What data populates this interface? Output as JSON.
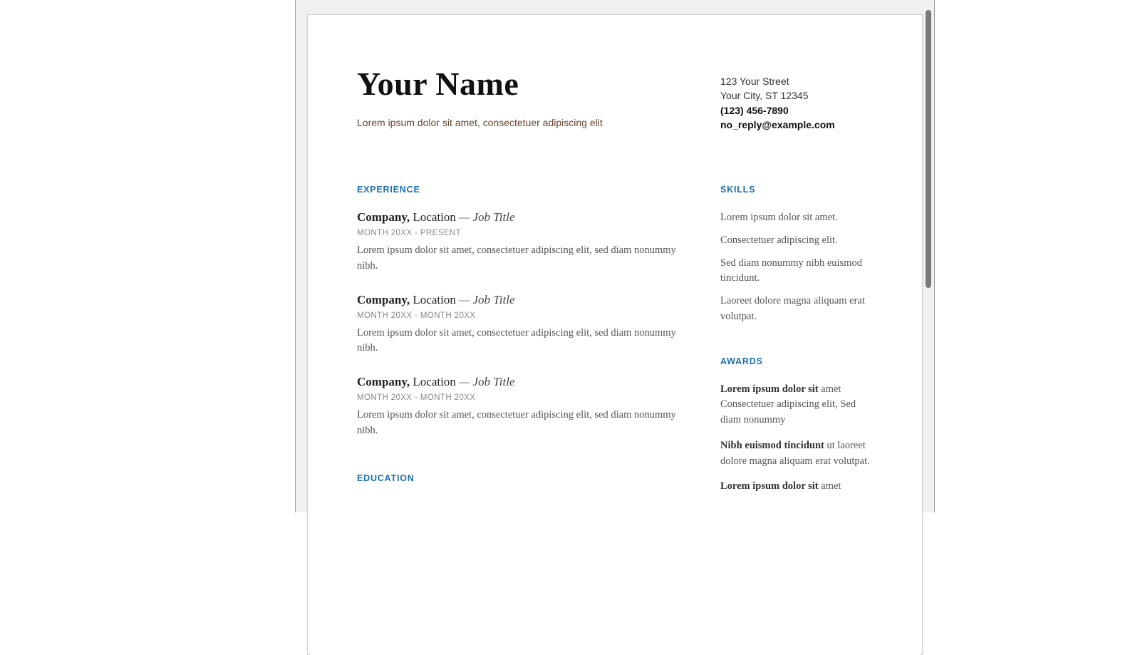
{
  "header": {
    "name": "Your Name",
    "tagline": "Lorem ipsum dolor sit amet, consectetuer adipiscing elit",
    "contact": {
      "street": "123 Your Street",
      "city": "Your City, ST 12345",
      "phone": "(123) 456-7890",
      "email": "no_reply@example.com"
    }
  },
  "experience": {
    "heading": "EXPERIENCE",
    "items": [
      {
        "company": "Company,",
        "location": "Location",
        "separator": " — ",
        "role": "Job Title",
        "dates": "MONTH 20XX - PRESENT",
        "body": "Lorem ipsum dolor sit amet, consectetuer adipiscing elit, sed diam nonummy nibh."
      },
      {
        "company": "Company,",
        "location": "Location",
        "separator": " — ",
        "role": "Job Title",
        "dates": "MONTH 20XX - MONTH 20XX",
        "body": "Lorem ipsum dolor sit amet, consectetuer adipiscing elit, sed diam nonummy nibh."
      },
      {
        "company": "Company,",
        "location": "Location",
        "separator": " — ",
        "role": "Job Title",
        "dates": "MONTH 20XX - MONTH 20XX",
        "body": "Lorem ipsum dolor sit amet, consectetuer adipiscing elit, sed diam nonummy nibh."
      }
    ]
  },
  "education": {
    "heading": "EDUCATION"
  },
  "skills": {
    "heading": "SKILLS",
    "lines": [
      "Lorem ipsum dolor sit amet.",
      "Consectetuer adipiscing elit.",
      "Sed diam nonummy nibh euismod tincidunt.",
      "Laoreet dolore magna aliquam erat volutpat."
    ]
  },
  "awards": {
    "heading": "AWARDS",
    "items": [
      {
        "lead": "Lorem ipsum dolor sit",
        "rest": " amet Consectetuer adipiscing elit, Sed diam nonummy"
      },
      {
        "lead": "Nibh euismod tincidunt",
        "rest": " ut laoreet dolore magna aliquam erat volutpat."
      },
      {
        "lead": "Lorem ipsum dolor sit",
        "rest": " amet"
      }
    ]
  }
}
